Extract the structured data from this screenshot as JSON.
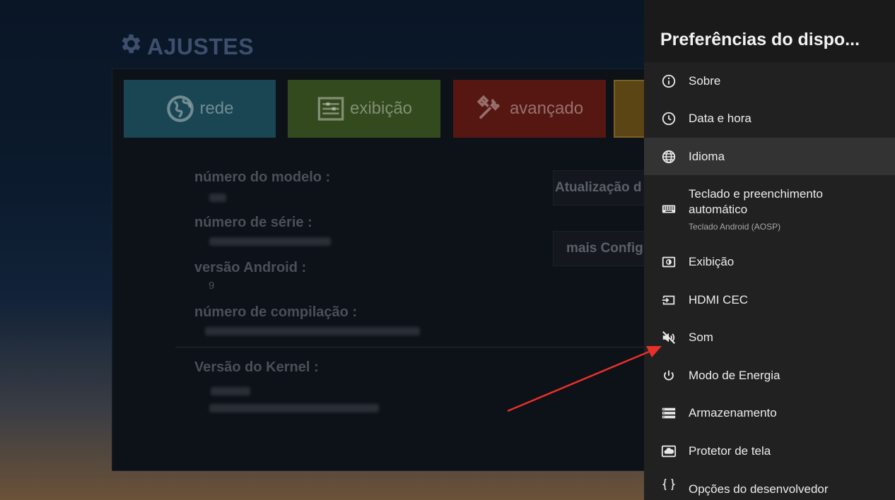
{
  "background": {
    "title": "AJUSTES",
    "tiles": [
      {
        "label": "rede",
        "icon": "globe-icon",
        "color": "#1a4552"
      },
      {
        "label": "exibição",
        "icon": "display-settings-icon",
        "color": "#33491e"
      },
      {
        "label": "avançado",
        "icon": "tools-icon",
        "color": "#561713"
      }
    ],
    "info": {
      "model_label": "número do modelo :",
      "serial_label": "número de série :",
      "android_label": "versão Android :",
      "android_value": "9",
      "build_label": "número de compilação :",
      "kernel_label": "Versão do Kernel :"
    },
    "buttons": {
      "update": "Atualização d",
      "more": "mais Config"
    }
  },
  "panel": {
    "title": "Preferências do dispo...",
    "items": [
      {
        "label": "Sobre",
        "icon": "info-icon"
      },
      {
        "label": "Data e hora",
        "icon": "clock-icon"
      },
      {
        "label": "Idioma",
        "icon": "globe-icon",
        "selected": true
      },
      {
        "label": "Teclado e preenchimento automático",
        "icon": "keyboard-icon",
        "subtitle": "Teclado Android (AOSP)"
      },
      {
        "label": "Exibição",
        "icon": "display-icon"
      },
      {
        "label": "HDMI CEC",
        "icon": "hdmi-input-icon"
      },
      {
        "label": "Som",
        "icon": "volume-off-icon"
      },
      {
        "label": "Modo de Energia",
        "icon": "power-icon"
      },
      {
        "label": "Armazenamento",
        "icon": "storage-icon"
      },
      {
        "label": "Protetor de tela",
        "icon": "screensaver-icon"
      },
      {
        "label": "Opções do desenvolvedor",
        "icon": "code-braces-icon"
      }
    ]
  },
  "colors": {
    "panel_bg": "#212121",
    "selected_bg": "#333333",
    "annotation_arrow": "#e8302a"
  }
}
